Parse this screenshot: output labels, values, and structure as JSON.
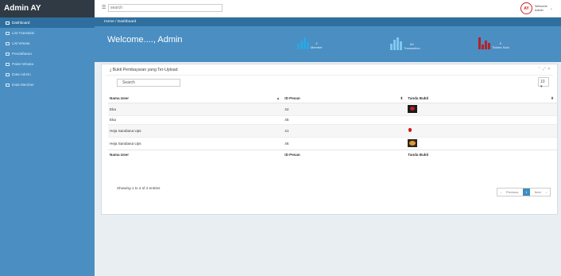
{
  "app": {
    "brand": "Admin AY"
  },
  "sidebar": {
    "items": [
      {
        "label": "Dashboard",
        "active": true
      },
      {
        "label": "List Transaksi"
      },
      {
        "label": "List Wisata"
      },
      {
        "label": "Pendaftaran"
      },
      {
        "label": "Paket Wisata"
      },
      {
        "label": "Data Admin"
      },
      {
        "label": "Data Member"
      }
    ]
  },
  "header": {
    "search_placeholder": "search",
    "user": {
      "welcome": "Welcome",
      "name": "Admin"
    }
  },
  "breadcrumb": "Home / Dashboard",
  "hero": {
    "welcome": "Welcome...., Admin",
    "stats": [
      {
        "value": "3",
        "label": "Member",
        "color": "#2aa7e1"
      },
      {
        "value": "AV",
        "label": "Transaction",
        "color": "#7fc8ef"
      },
      {
        "value": "5",
        "label": "Tickets Sold",
        "color": "#b4222a"
      }
    ]
  },
  "panel": {
    "title": "Bukti Pembayaran yang Ter-Upload",
    "search_value": "Search",
    "page_size": "10",
    "columns": [
      "Nama User",
      "ID Pesan",
      "Tanda Bukti"
    ],
    "rows": [
      {
        "name": "Eka",
        "id": "42",
        "proof": "red-dark-image"
      },
      {
        "name": "Eka",
        "id": "45",
        "proof": ""
      },
      {
        "name": "Heja Sandiana Ups",
        "id": "41",
        "proof": "red-pin-image"
      },
      {
        "name": "Heja Sandiana Ups",
        "id": "46",
        "proof": "orange-photo-image"
      }
    ],
    "footer_columns": [
      "Nama User",
      "ID Pesan",
      "Tanda Bukti"
    ],
    "showing": "Showing 1 to 4 of 4 entries",
    "pagination": {
      "prev": "Previous",
      "current": "1",
      "next": "Next"
    }
  }
}
